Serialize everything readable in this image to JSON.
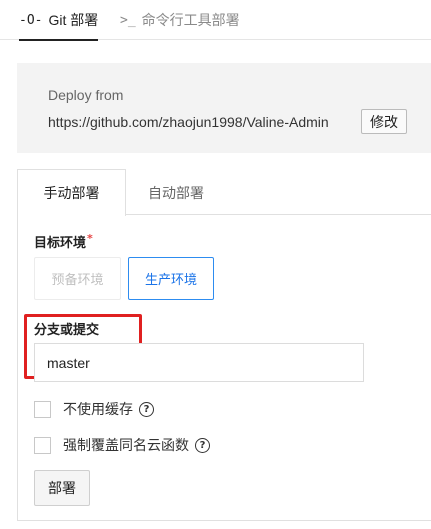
{
  "top_tabs": [
    {
      "icon": "-O-",
      "label": "Git 部署"
    },
    {
      "icon": ">_",
      "label": "命令行工具部署"
    }
  ],
  "deploy": {
    "label": "Deploy from",
    "url": "https://github.com/zhaojun1998/Valine-Admin",
    "modify_label": "修改"
  },
  "subtabs": {
    "manual": "手动部署",
    "auto": "自动部署"
  },
  "env": {
    "label": "目标环境",
    "required_mark": "*",
    "options": [
      "预备环境",
      "生产环境"
    ],
    "selected": "生产环境"
  },
  "branch": {
    "label": "分支或提交",
    "value": "master"
  },
  "options": {
    "no_cache_label": "不使用缓存",
    "override_label": "强制覆盖同名云函数",
    "help_glyph": "?"
  },
  "deploy_button": "部署",
  "colors": {
    "highlight": "#e02020",
    "selected_accent": "#2d8cf0"
  }
}
